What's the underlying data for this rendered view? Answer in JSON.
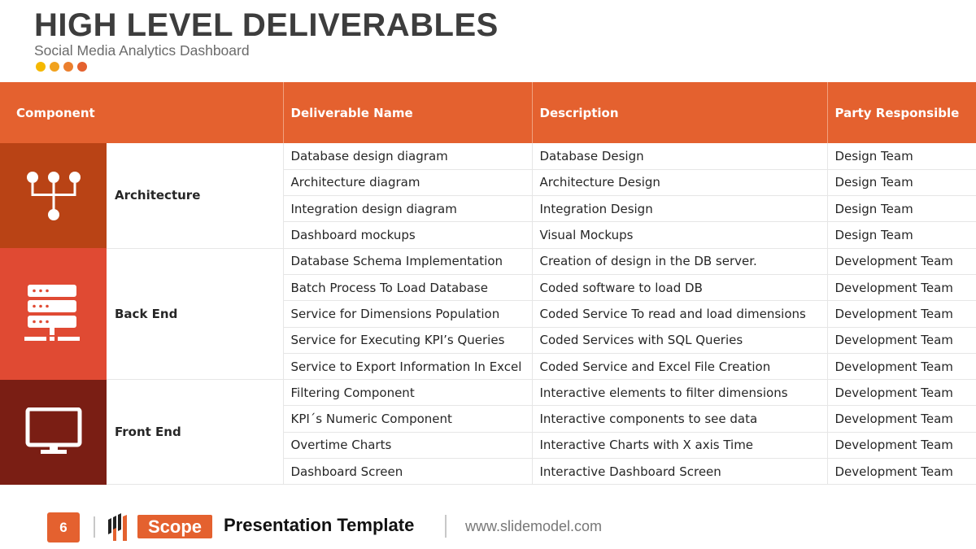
{
  "header": {
    "title": "HIGH LEVEL DELIVERABLES",
    "subtitle": "Social Media Analytics Dashboard",
    "dot_colors": [
      "#f5b800",
      "#f1a21e",
      "#eb7f2e",
      "#e4612f"
    ]
  },
  "table": {
    "columns": [
      "Component",
      "Deliverable Name",
      "Description",
      "Party Responsible"
    ],
    "groups": [
      {
        "component": "Architecture",
        "icon": "hierarchy-network-icon",
        "color": "#b94315",
        "rows": [
          {
            "deliverable": "Database design diagram",
            "description": "Database Design",
            "party": "Design Team"
          },
          {
            "deliverable": "Architecture diagram",
            "description": "Architecture Design",
            "party": "Design Team"
          },
          {
            "deliverable": "Integration design diagram",
            "description": "Integration Design",
            "party": "Design Team"
          },
          {
            "deliverable": "Dashboard mockups",
            "description": "Visual Mockups",
            "party": "Design Team"
          }
        ]
      },
      {
        "component": "Back End",
        "icon": "server-stack-icon",
        "color": "#e04a33",
        "rows": [
          {
            "deliverable": "Database Schema Implementation",
            "description": "Creation of design in the DB server.",
            "party": "Development Team"
          },
          {
            "deliverable": "Batch Process To Load Database",
            "description": "Coded software to load DB",
            "party": "Development Team"
          },
          {
            "deliverable": "Service for Dimensions Population",
            "description": "Coded Service To read and load dimensions",
            "party": "Development Team"
          },
          {
            "deliverable": "Service for Executing KPI’s Queries",
            "description": "Coded Services with SQL Queries",
            "party": "Development Team"
          },
          {
            "deliverable": "Service to Export Information In Excel",
            "description": "Coded Service and Excel File Creation",
            "party": "Development Team"
          }
        ]
      },
      {
        "component": "Front End",
        "icon": "monitor-icon",
        "color": "#7a1e14",
        "rows": [
          {
            "deliverable": "Filtering Component",
            "description": "Interactive elements to filter dimensions",
            "party": "Development Team"
          },
          {
            "deliverable": "KPI´s Numeric Component",
            "description": "Interactive components to see data",
            "party": "Development Team"
          },
          {
            "deliverable": "Overtime Charts",
            "description": "Interactive Charts with X axis Time",
            "party": "Development Team"
          },
          {
            "deliverable": "Dashboard Screen",
            "description": "Interactive Dashboard Screen",
            "party": "Development Team"
          }
        ]
      }
    ]
  },
  "footer": {
    "page_number": "6",
    "badge": "Scope",
    "template_title": "Presentation Template",
    "website": "www.slidemodel.com",
    "accent": "#e4612f"
  }
}
